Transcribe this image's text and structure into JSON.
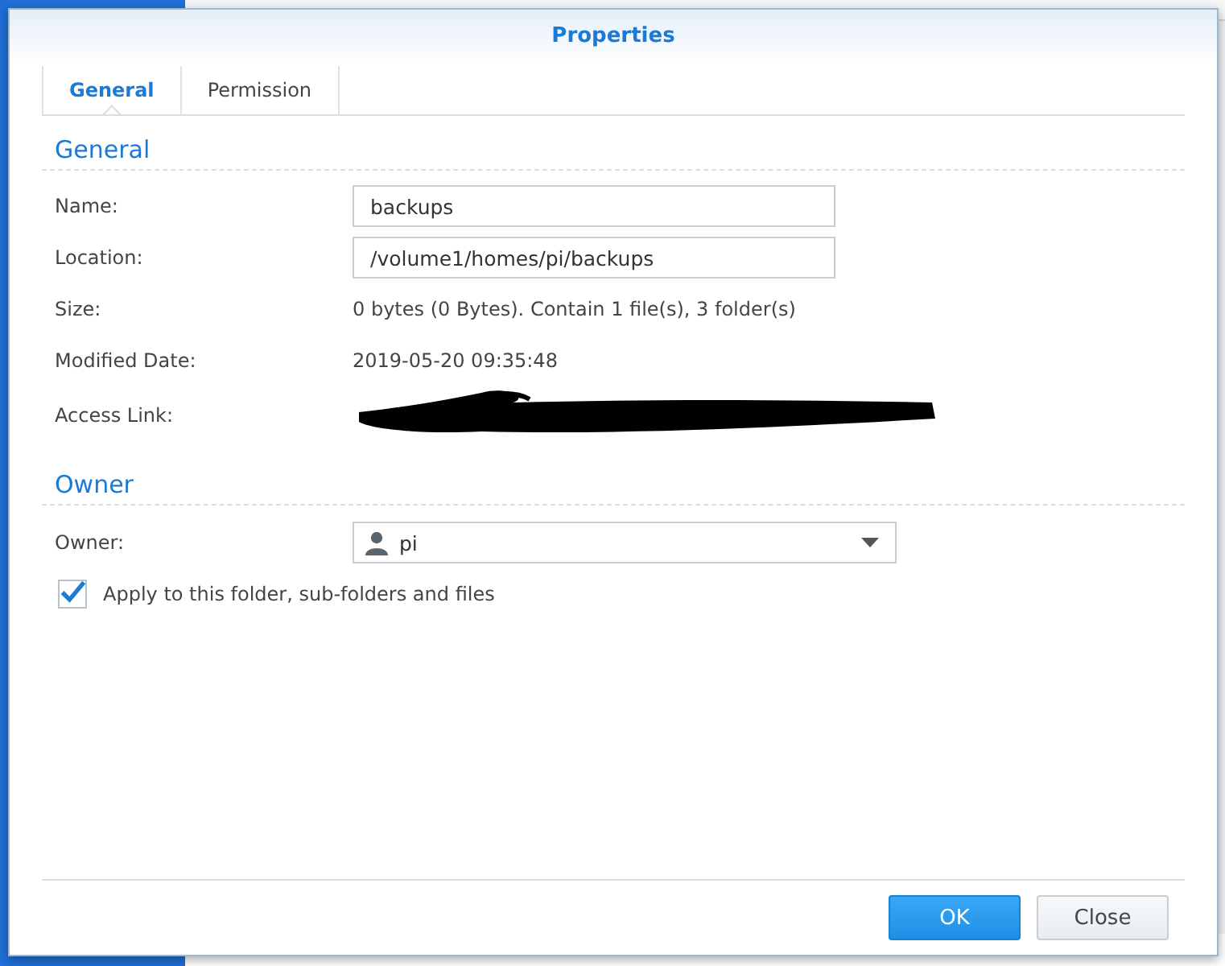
{
  "window": {
    "title": "Properties"
  },
  "tabs": [
    {
      "label": "General",
      "selected": true
    },
    {
      "label": "Permission",
      "selected": false
    }
  ],
  "general": {
    "heading": "General",
    "rows": [
      {
        "kind": "input",
        "label": "Name:",
        "value": "backups"
      },
      {
        "kind": "input",
        "label": "Location:",
        "value": "/volume1/homes/pi/backups"
      },
      {
        "kind": "text",
        "label": "Size:",
        "value": "0 bytes (0 Bytes). Contain 1 file(s), 3 folder(s)"
      },
      {
        "kind": "text",
        "label": "Modified Date:",
        "value": "2019-05-20 09:35:48"
      },
      {
        "kind": "redacted",
        "label": "Access Link:"
      }
    ]
  },
  "owner": {
    "heading": "Owner",
    "label": "Owner:",
    "value": "pi",
    "apply": {
      "label": "Apply to this folder, sub-folders and files",
      "checked": true
    }
  },
  "buttons": [
    {
      "label": "OK",
      "kind": "primary"
    },
    {
      "label": "Close",
      "kind": "secondary"
    }
  ]
}
